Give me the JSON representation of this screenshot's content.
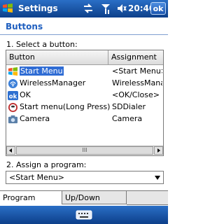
{
  "titlebar": {
    "app_title": "Settings",
    "clock": "20:40",
    "ok_label": "ok",
    "status_icons": [
      "connectivity-icon",
      "signal-icon",
      "volume-icon"
    ]
  },
  "page": {
    "section_title": "Buttons",
    "select_label": "1. Select a button:",
    "assign_label": "2. Assign a program:"
  },
  "listview": {
    "columns": [
      "Button",
      "Assignment"
    ],
    "rows": [
      {
        "name": "Start Menu",
        "assignment": "<Start Menu>",
        "icon": "start-menu-icon",
        "selected": true
      },
      {
        "name": "WirelessManager",
        "assignment": "WirelessManag",
        "icon": "wireless-manager-icon"
      },
      {
        "name": "OK",
        "assignment": "<OK/Close>",
        "icon": "ok-icon"
      },
      {
        "name": "Start menu(Long Press)",
        "assignment": "SDDialer",
        "icon": "speed-dial-icon"
      },
      {
        "name": "Camera",
        "assignment": "Camera",
        "icon": "camera-icon"
      }
    ],
    "scroll_thumb": "III"
  },
  "combo": {
    "value": "<Start Menu>"
  },
  "tabs": [
    "Program Buttons",
    "Up/Down Control"
  ],
  "colors": {
    "titlebar": "#1a56b0",
    "accent": "#1f5fbf",
    "selection": "#2f6cd4"
  }
}
